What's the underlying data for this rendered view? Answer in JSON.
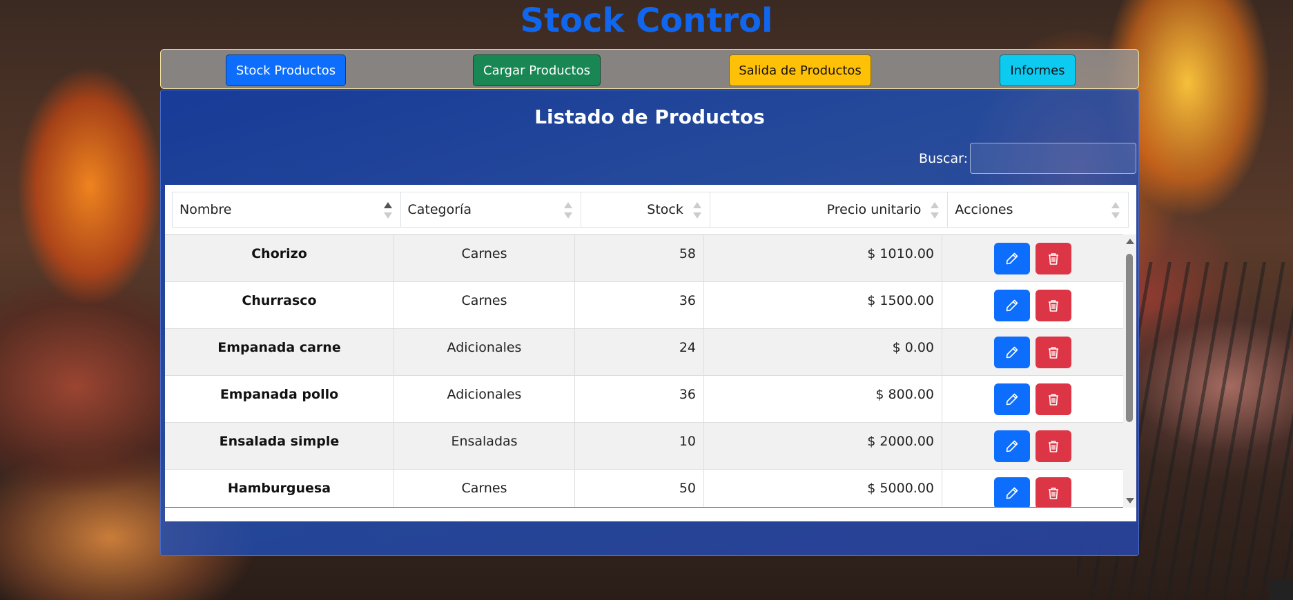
{
  "app": {
    "title": "Stock Control"
  },
  "nav": {
    "stock": "Stock Productos",
    "cargar": "Cargar Productos",
    "salida": "Salida de Productos",
    "informes": "Informes"
  },
  "panel": {
    "heading": "Listado de Productos",
    "search_label": "Buscar:",
    "search_value": ""
  },
  "table": {
    "columns": [
      "Nombre",
      "Categoría",
      "Stock",
      "Precio unitario",
      "Acciones"
    ],
    "sorted_column": "Nombre",
    "rows": [
      {
        "nombre": "Chorizo",
        "categoria": "Carnes",
        "stock": "58",
        "precio": "$ 1010.00"
      },
      {
        "nombre": "Churrasco",
        "categoria": "Carnes",
        "stock": "36",
        "precio": "$ 1500.00"
      },
      {
        "nombre": "Empanada carne",
        "categoria": "Adicionales",
        "stock": "24",
        "precio": "$ 0.00"
      },
      {
        "nombre": "Empanada pollo",
        "categoria": "Adicionales",
        "stock": "36",
        "precio": "$ 800.00"
      },
      {
        "nombre": "Ensalada simple",
        "categoria": "Ensaladas",
        "stock": "10",
        "precio": "$ 2000.00"
      },
      {
        "nombre": "Hamburguesa",
        "categoria": "Carnes",
        "stock": "50",
        "precio": "$ 5000.00"
      }
    ],
    "row_actions": {
      "edit_icon": "pencil-icon",
      "delete_icon": "trash-icon"
    }
  },
  "colors": {
    "title": "#1166ee",
    "primary": "#0d6efd",
    "success": "#198754",
    "warning": "#ffc107",
    "info": "#0dcaf0",
    "danger": "#dc3545"
  }
}
